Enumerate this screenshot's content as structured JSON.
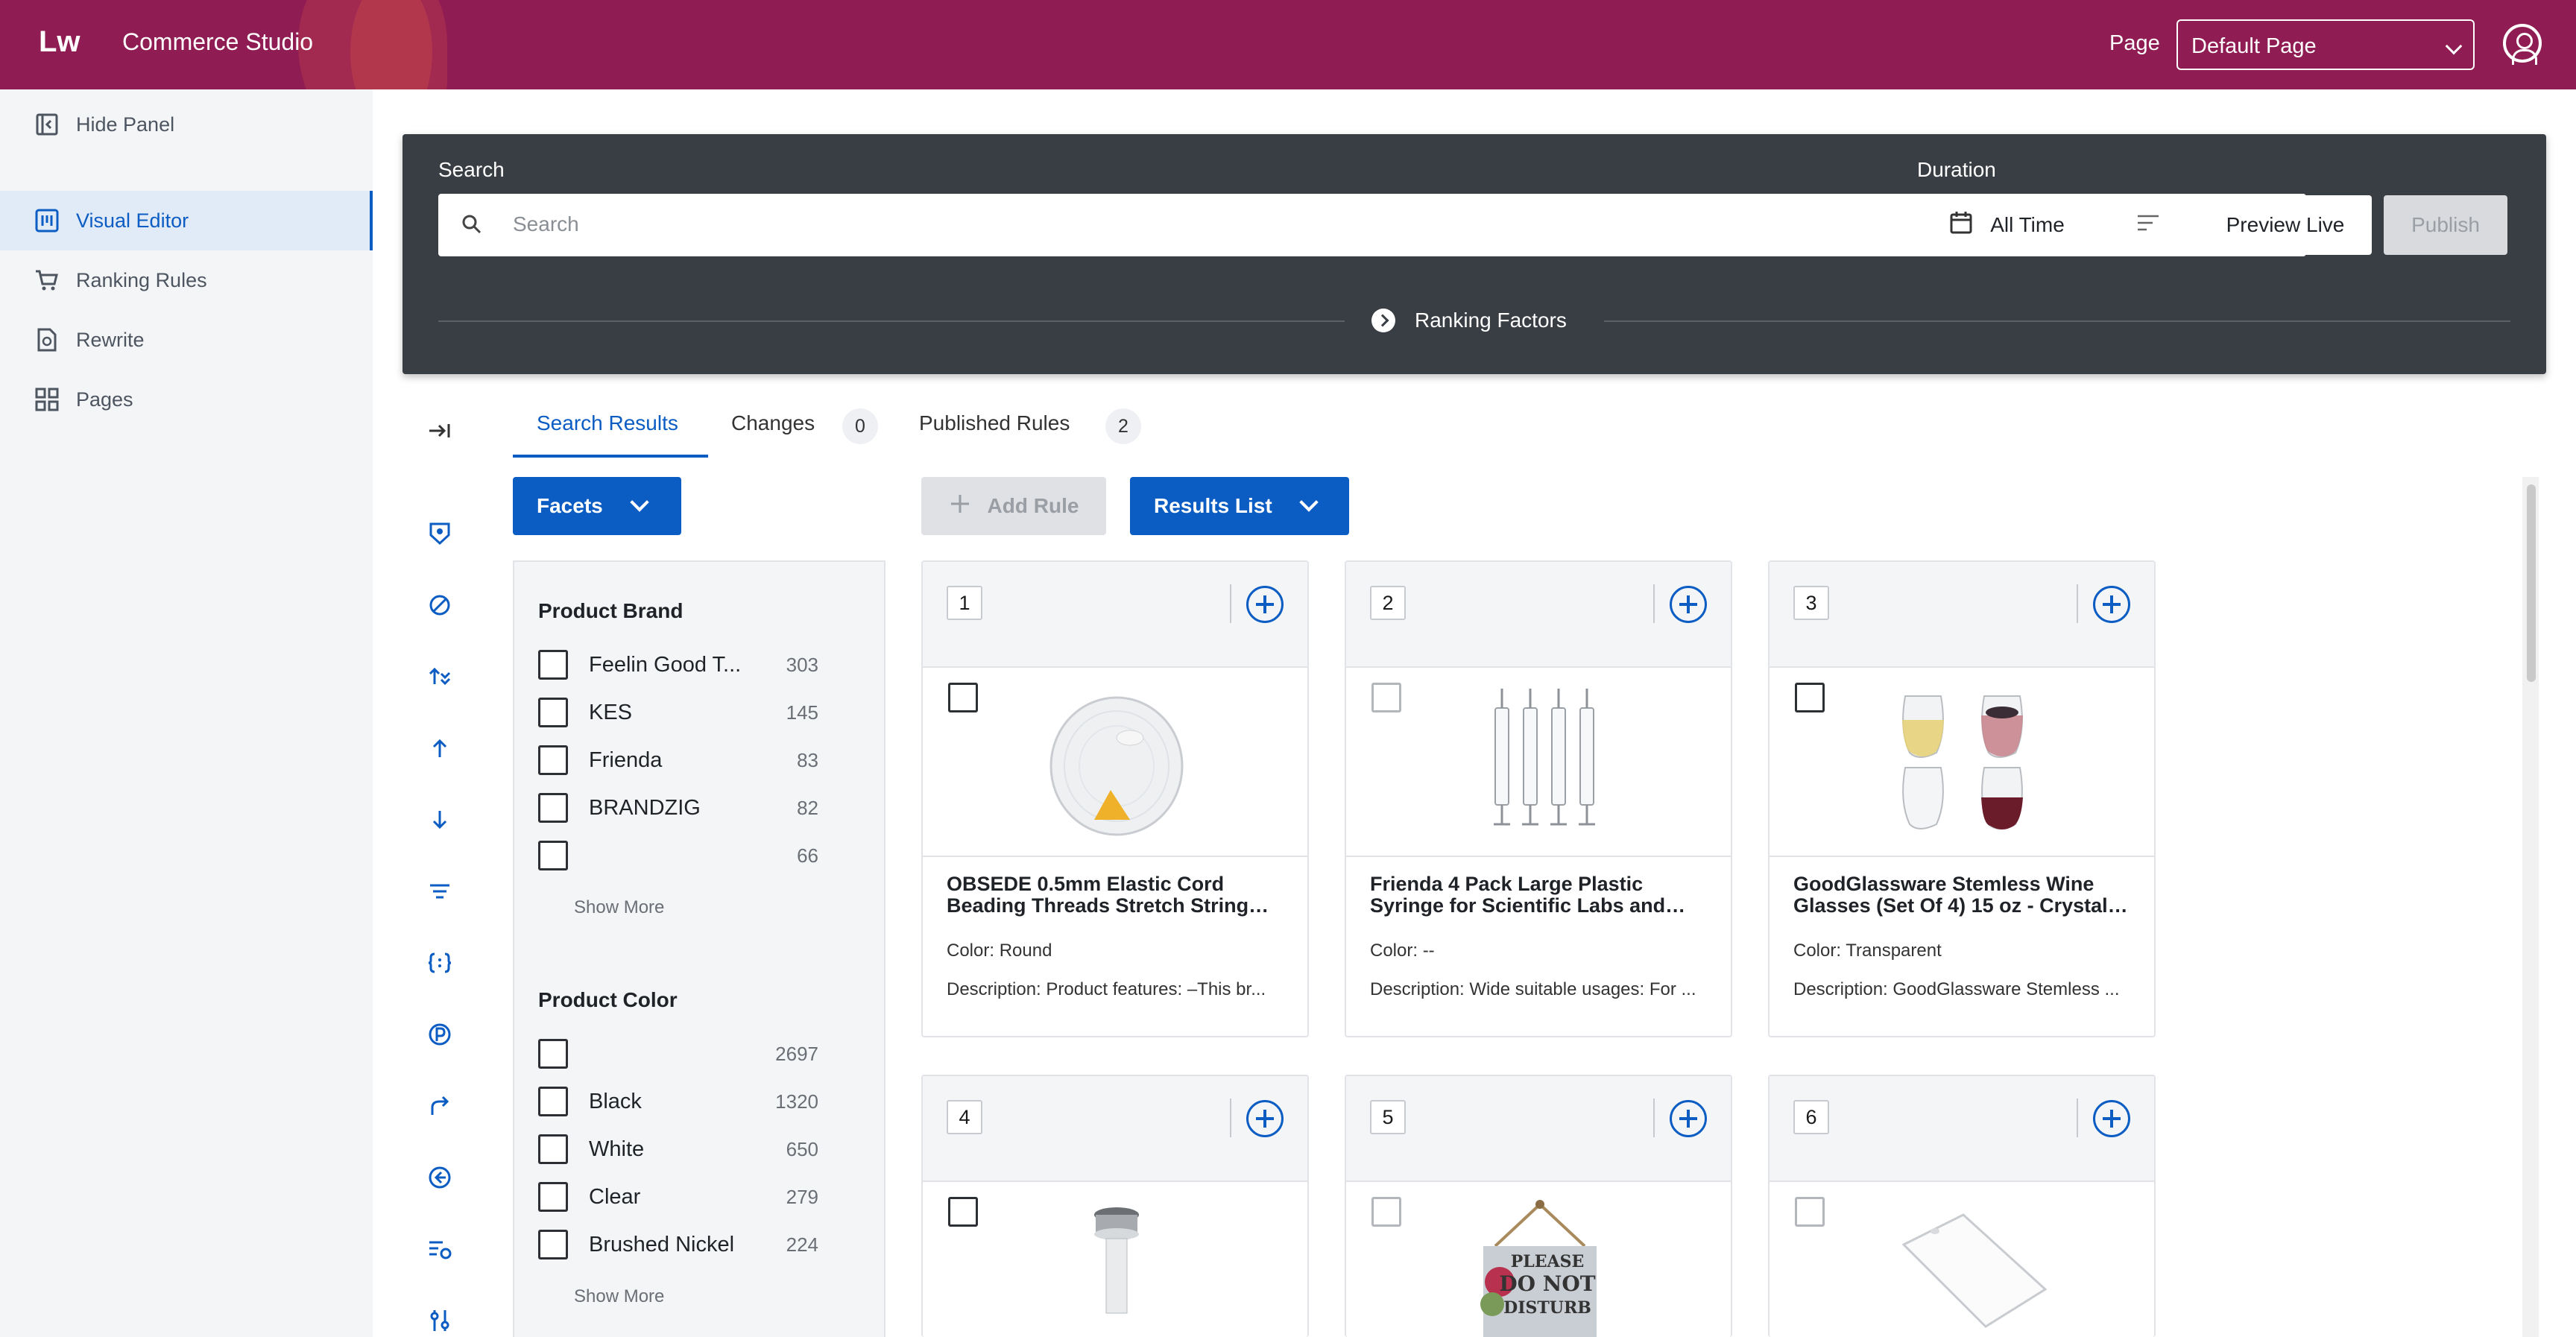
{
  "header": {
    "logo": "Lw",
    "app_name": "Commerce Studio",
    "page_label": "Page",
    "page_select_value": "Default Page"
  },
  "sidebar": {
    "hide_panel": "Hide Panel",
    "items": [
      {
        "label": "Visual Editor",
        "icon": "visual-editor-icon",
        "active": true
      },
      {
        "label": "Ranking Rules",
        "icon": "cart-icon",
        "active": false
      },
      {
        "label": "Rewrite",
        "icon": "rewrite-icon",
        "active": false
      },
      {
        "label": "Pages",
        "icon": "pages-grid-icon",
        "active": false
      }
    ]
  },
  "search_panel": {
    "search_label": "Search",
    "search_placeholder": "Search",
    "duration_label": "Duration",
    "duration_value": "All Time",
    "preview_live": "Preview Live",
    "publish": "Publish",
    "ranking_factors": "Ranking Factors"
  },
  "tabs": [
    {
      "label": "Search Results",
      "count": null,
      "active": true
    },
    {
      "label": "Changes",
      "count": "0",
      "active": false
    },
    {
      "label": "Published Rules",
      "count": "2",
      "active": false
    }
  ],
  "toolbar": {
    "facets": "Facets",
    "add_rule": "Add Rule",
    "results_list": "Results List"
  },
  "facets": [
    {
      "title": "Product Brand",
      "items": [
        {
          "name": "Feelin Good T...",
          "count": "303"
        },
        {
          "name": "KES",
          "count": "145"
        },
        {
          "name": "Frienda",
          "count": "83"
        },
        {
          "name": "BRANDZIG",
          "count": "82"
        },
        {
          "name": "",
          "count": "66"
        }
      ],
      "show_more": "Show More"
    },
    {
      "title": "Product Color",
      "items": [
        {
          "name": "",
          "count": "2697"
        },
        {
          "name": "Black",
          "count": "1320"
        },
        {
          "name": "White",
          "count": "650"
        },
        {
          "name": "Clear",
          "count": "279"
        },
        {
          "name": "Brushed Nickel",
          "count": "224"
        }
      ],
      "show_more": "Show More"
    }
  ],
  "results": [
    {
      "position": "1",
      "title": "OBSEDE 0.5mm Elastic Cord Beading Threads Stretch String…",
      "color": "Color: Round",
      "description": "Description: Product features: –This br...",
      "image": "thread-spool"
    },
    {
      "position": "2",
      "title": "Frienda 4 Pack Large Plastic Syringe for Scientific Labs and…",
      "color": "Color: --",
      "description": "Description: Wide suitable usages: For ...",
      "image": "syringes"
    },
    {
      "position": "3",
      "title": "GoodGlassware Stemless Wine Glasses (Set Of 4) 15 oz - Crystal…",
      "color": "Color: Transparent",
      "description": "Description: GoodGlassware Stemless ...",
      "image": "wine-glasses"
    },
    {
      "position": "4",
      "title": "",
      "color": "",
      "description": "",
      "image": "drain-stopper"
    },
    {
      "position": "5",
      "title": "",
      "color": "",
      "description": "",
      "image": "door-sign",
      "sign_text": [
        "PLEASE",
        "DO NOT",
        "DISTURB"
      ]
    },
    {
      "position": "6",
      "title": "",
      "color": "",
      "description": "",
      "image": "white-board"
    }
  ],
  "colors": {
    "header_bg": "#8f1c52",
    "accent": "#0b5cc3",
    "panel_dark": "#393d44"
  }
}
